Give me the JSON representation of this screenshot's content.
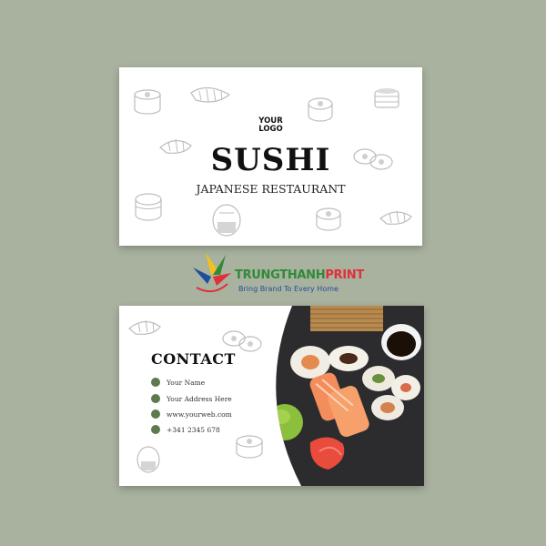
{
  "front": {
    "logo_line1": "YOUR",
    "logo_line2": "LOGO",
    "title": "SUSHI",
    "subtitle": "JAPANESE RESTAURANT"
  },
  "back": {
    "contact_title": "CONTACT",
    "items": [
      {
        "icon": "user-icon",
        "text": "Your Name"
      },
      {
        "icon": "phone-icon",
        "text": "Your Address Here"
      },
      {
        "icon": "location-icon",
        "text": "www.yourweb.com"
      },
      {
        "icon": "globe-icon",
        "text": "+341 2345 678"
      }
    ]
  },
  "watermark": {
    "name_part1": "TRUNGTHANH",
    "name_part2": "PRINT",
    "tagline": "Bring Brand To Every Home"
  },
  "colors": {
    "background": "#a9b29f",
    "accent_green": "#5d7a4e",
    "brand_green": "#2f8a3a",
    "brand_red": "#e0303a",
    "brand_blue": "#1f4f9a"
  }
}
